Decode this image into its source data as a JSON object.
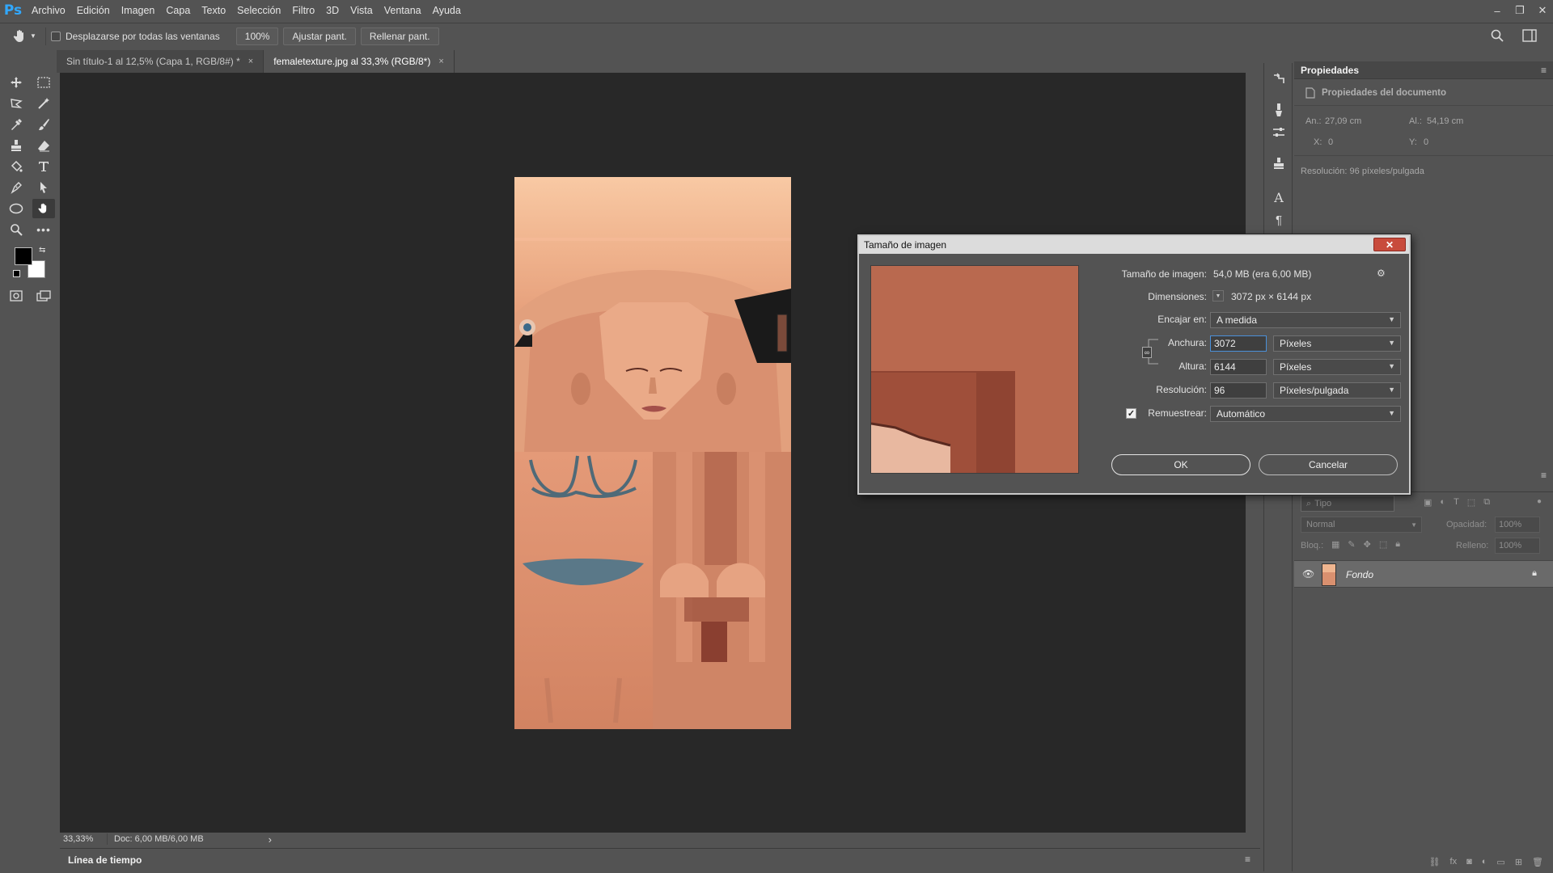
{
  "app": {
    "logo": "Ps"
  },
  "menu": [
    "Archivo",
    "Edición",
    "Imagen",
    "Capa",
    "Texto",
    "Selección",
    "Filtro",
    "3D",
    "Vista",
    "Ventana",
    "Ayuda"
  ],
  "window_controls": {
    "minimize": "–",
    "restore": "❐",
    "close": "✕"
  },
  "options": {
    "scroll_all_label": "Desplazarse por todas las ventanas",
    "zoom_value": "100%",
    "fit_screen": "Ajustar pant.",
    "fill_screen": "Rellenar pant."
  },
  "tabs": [
    {
      "label": "Sin título-1 al 12,5% (Capa 1, RGB/8#) *",
      "close": "×",
      "active": false
    },
    {
      "label": "femaletexture.jpg al 33,3% (RGB/8*)",
      "close": "×",
      "active": true
    }
  ],
  "status": {
    "zoom": "33,33%",
    "doc": "Doc: 6,00 MB/6,00 MB",
    "arrow": "›"
  },
  "timeline": {
    "label": "Línea de tiempo"
  },
  "properties": {
    "title": "Propiedades",
    "section": "Propiedades del documento",
    "width_label": "An.:",
    "width_value": "27,09 cm",
    "height_label": "Al.:",
    "height_value": "54,19 cm",
    "x_label": "X:",
    "x_value": "0",
    "y_label": "Y:",
    "y_value": "0",
    "resolution": "Resolución: 96 píxeles/pulgada"
  },
  "layers": {
    "search_placeholder": "Tipo",
    "blend_mode": "Normal",
    "opacity_label": "Opacidad:",
    "opacity_value": "100%",
    "lock_label": "Bloq.:",
    "fill_label": "Relleno:",
    "fill_value": "100%",
    "layer_name": "Fondo"
  },
  "dialog": {
    "title": "Tamaño de imagen",
    "close": "✕",
    "size_label": "Tamaño de imagen:",
    "size_value": "54,0 MB (era 6,00 MB)",
    "dimensions_label": "Dimensiones:",
    "dimensions_value": "3072 px × 6144 px",
    "fit_label": "Encajar en:",
    "fit_value": "A medida",
    "width_label": "Anchura:",
    "width_value": "3072",
    "width_unit": "Píxeles",
    "height_label": "Altura:",
    "height_value": "6144",
    "height_unit": "Píxeles",
    "resolution_label": "Resolución:",
    "resolution_value": "96",
    "resolution_unit": "Píxeles/pulgada",
    "resample_label": "Remuestrear:",
    "resample_value": "Automático",
    "ok": "OK",
    "cancel": "Cancelar"
  },
  "colors": {
    "accent": "#31a8ff",
    "canvas_bg": "#282828",
    "panel_bg": "#535353",
    "close_red": "#c84b3c"
  }
}
